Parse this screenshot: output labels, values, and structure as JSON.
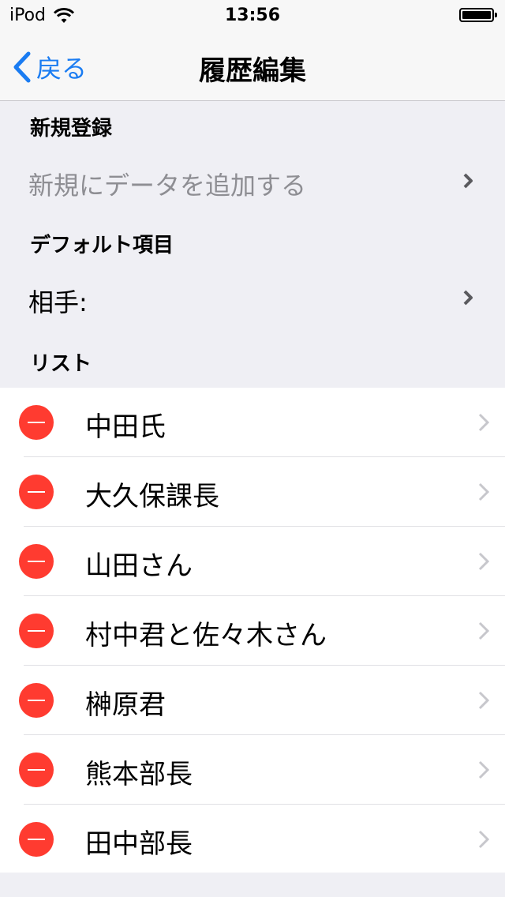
{
  "status_bar": {
    "device": "iPod",
    "time": "13:56"
  },
  "nav": {
    "back_label": "戻る",
    "title": "履歴編集"
  },
  "sections": {
    "new_header": "新規登録",
    "new_row": "新規にデータを追加する",
    "default_header": "デフォルト項目",
    "default_row": "相手:",
    "list_header": "リスト"
  },
  "list_items": [
    "中田氏",
    "大久保課長",
    "山田さん",
    "村中君と佐々木さん",
    "榊原君",
    "熊本部長",
    "田中部長"
  ],
  "colors": {
    "accent": "#1a7cf2",
    "delete": "#ff3b30",
    "background": "#efeff4",
    "muted_text": "#8e8e93"
  }
}
